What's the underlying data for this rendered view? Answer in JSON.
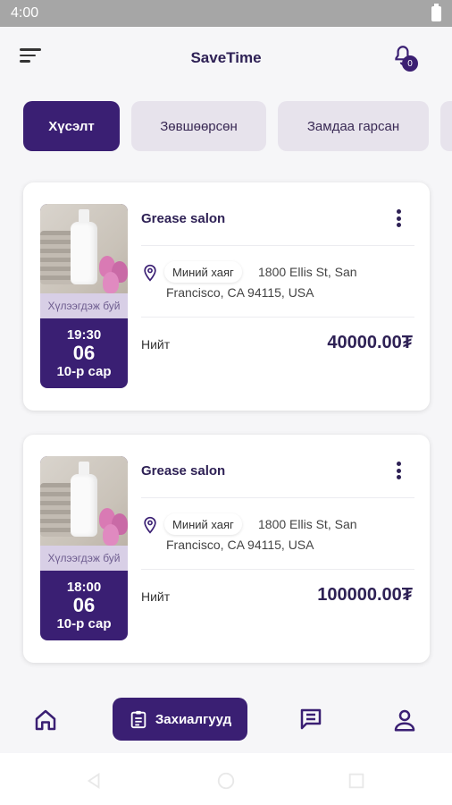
{
  "status_bar": {
    "time": "4:00"
  },
  "header": {
    "title": "SaveTime",
    "notification_count": "0"
  },
  "tabs": [
    {
      "label": "Хүсэлт",
      "active": true
    },
    {
      "label": "Зөвшөөрсөн",
      "active": false
    },
    {
      "label": "Замдаа гарсан",
      "active": false
    }
  ],
  "bookings": [
    {
      "salon": "Grease salon",
      "status_label": "Хүлээгдэж буй",
      "time": "19:30",
      "day": "06",
      "month": "10-р сар",
      "address_chip": "Миний хаяг",
      "address_line1": "1800 Ellis St, San",
      "address_line2": "Francisco, CA 94115, USA",
      "total_label": "Нийт",
      "total": "40000.00₮"
    },
    {
      "salon": "Grease salon",
      "status_label": "Хүлээгдэж буй",
      "time": "18:00",
      "day": "06",
      "month": "10-р сар",
      "address_chip": "Миний хаяг",
      "address_line1": "1800 Ellis St, San",
      "address_line2": "Francisco, CA 94115, USA",
      "total_label": "Нийт",
      "total": "100000.00₮"
    }
  ],
  "bottom_nav": {
    "items": [
      {
        "icon": "home-icon"
      },
      {
        "icon": "orders-icon",
        "label": "Захиалгууд",
        "active": true
      },
      {
        "icon": "chat-icon"
      },
      {
        "icon": "profile-icon"
      }
    ]
  },
  "colors": {
    "primary": "#3a1f73",
    "tab_inactive": "#e7e3ec",
    "background": "#f6f6f8"
  }
}
